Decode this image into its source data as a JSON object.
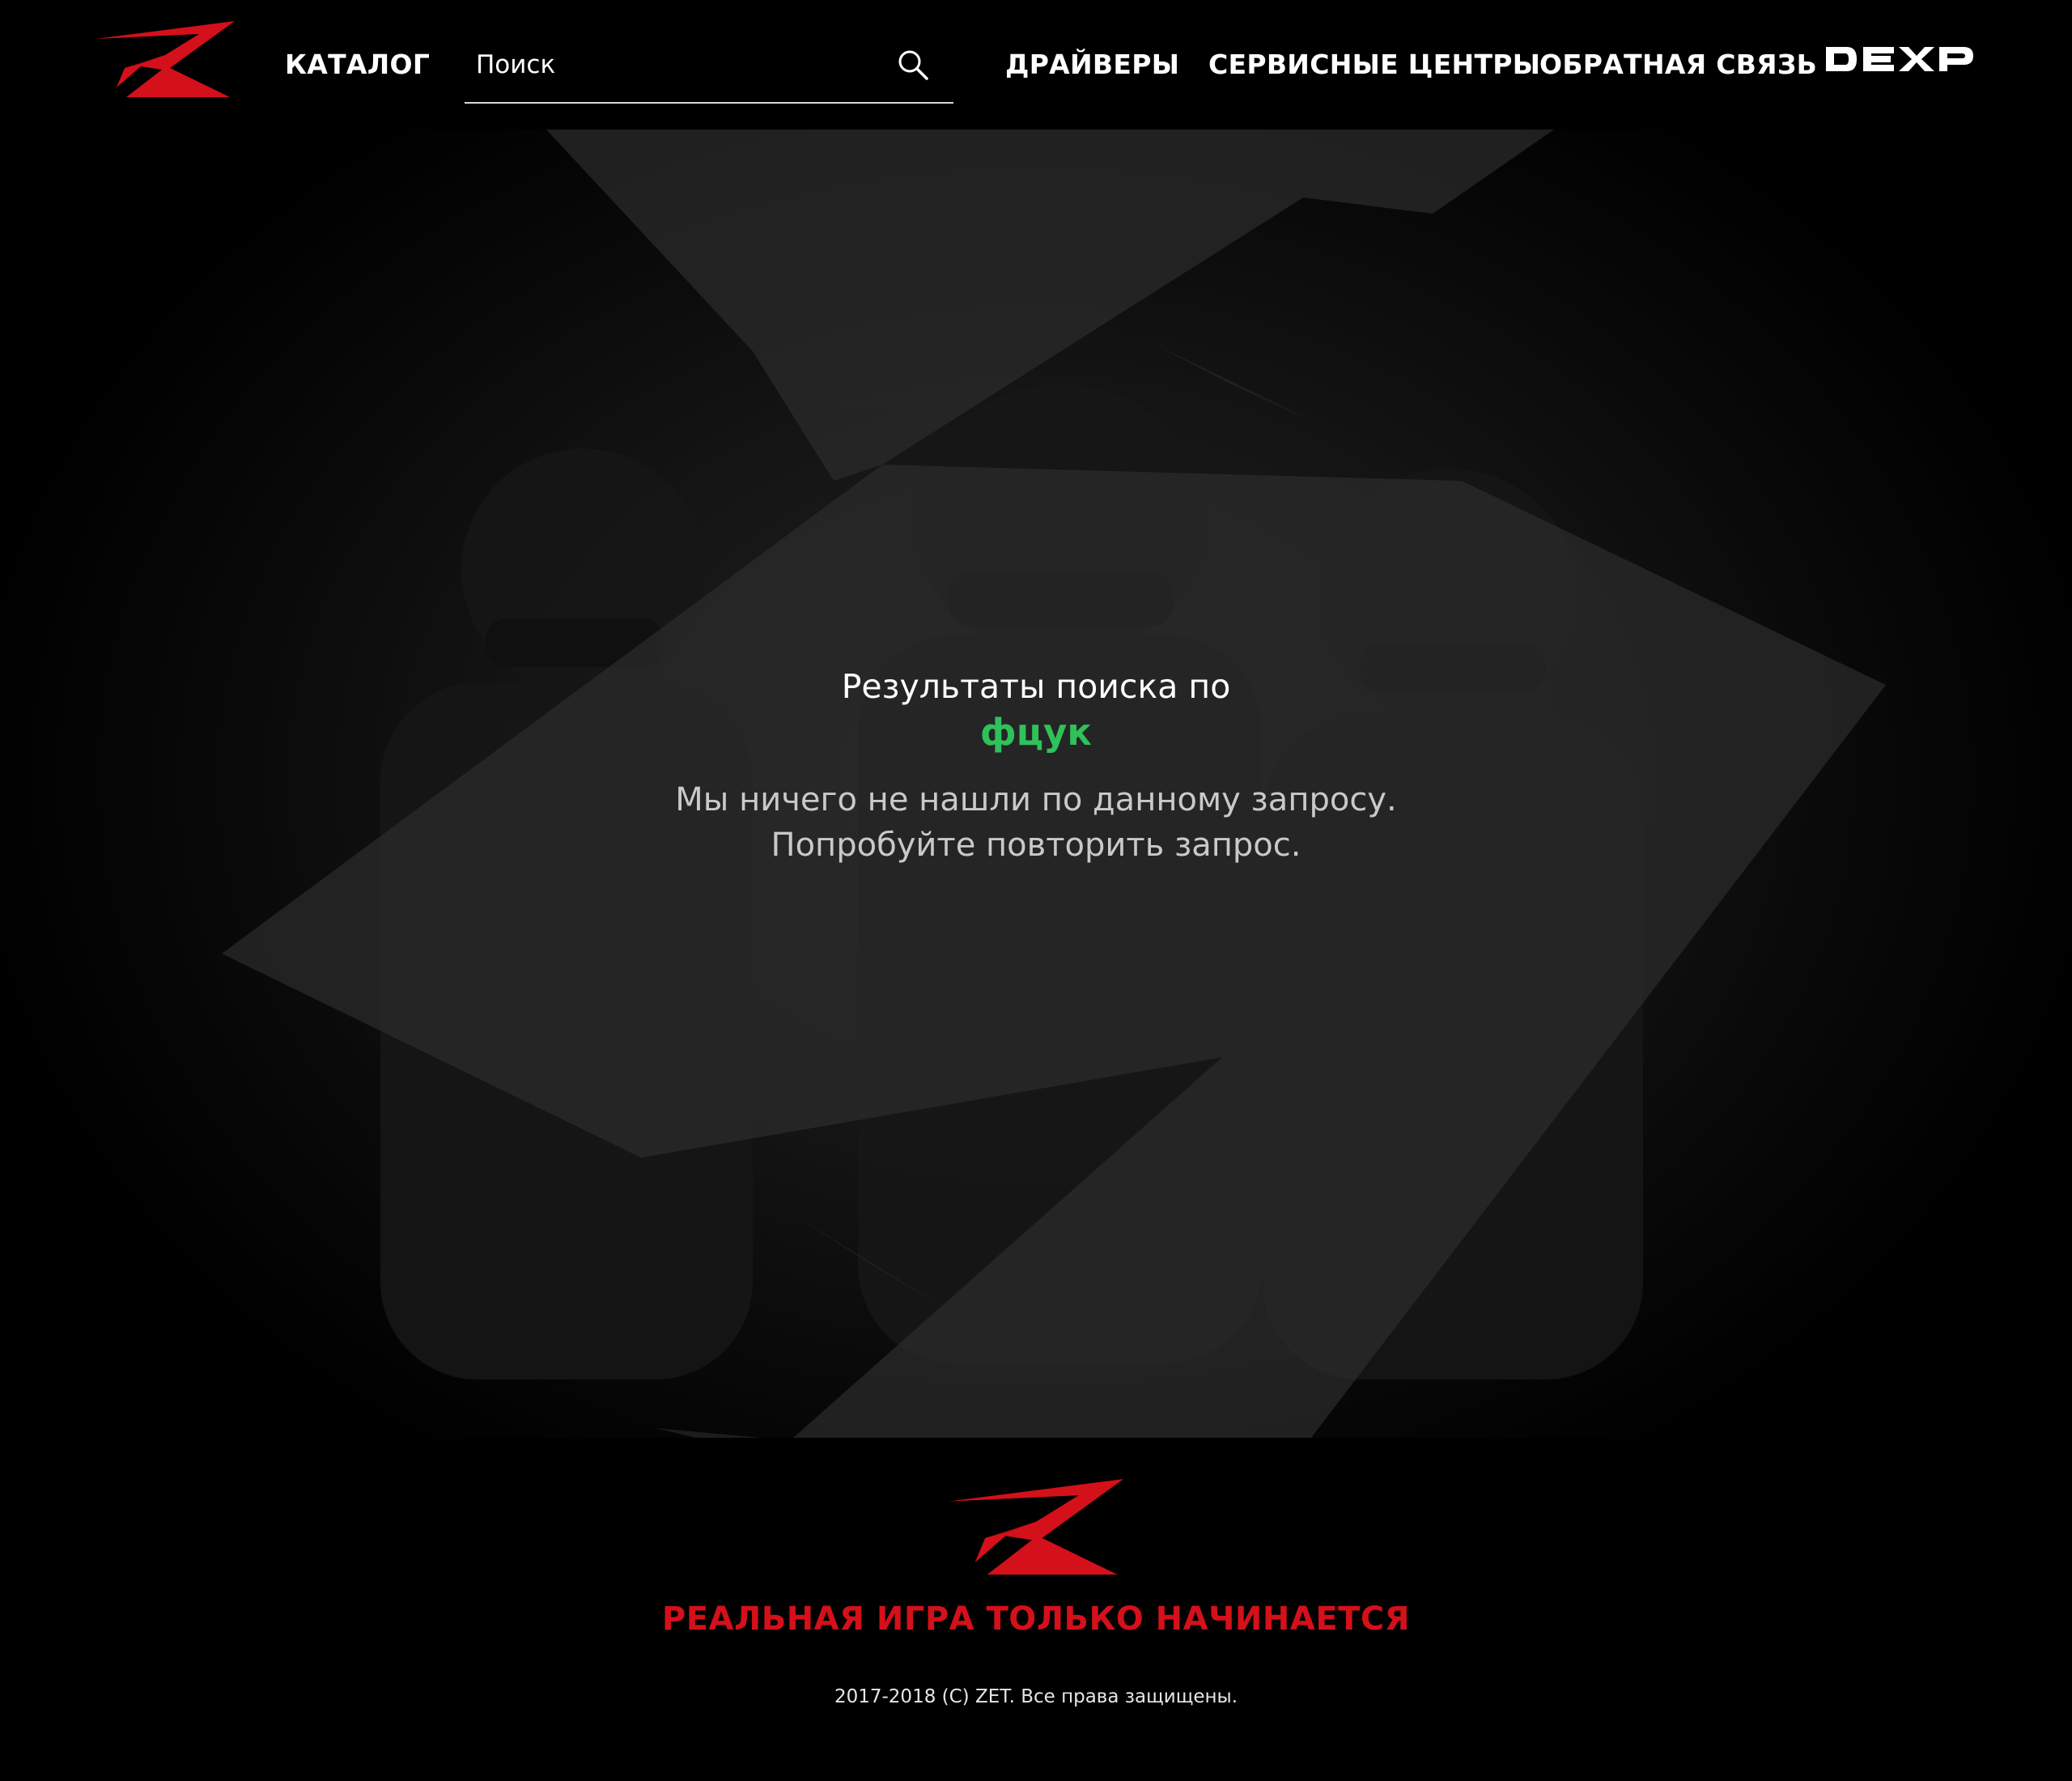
{
  "header": {
    "nav_catalog": "КАТАЛОГ",
    "search_placeholder": "Поиск",
    "nav_drivers": "ДРАЙВЕРЫ",
    "nav_service_centers": "СЕРВИСНЫЕ ЦЕНТРЫ",
    "nav_feedback": "ОБРАТНАЯ СВЯЗЬ",
    "brand_logo_text": "DEXP",
    "logo_icon": "zet-logo-icon"
  },
  "results": {
    "title": "Результаты поиска по",
    "query": "фцук",
    "message_line1": "Мы ничего не нашли по данному запросу.",
    "message_line2": "Попробуйте повторить запрос."
  },
  "footer": {
    "slogan": "РЕАЛЬНАЯ ИГРА ТОЛЬКО НАЧИНАЕТСЯ",
    "copyright": "2017-2018 (C) ZET. Все права защищены."
  },
  "colors": {
    "background": "#000000",
    "accent_red": "#d4101a",
    "query_green": "#2fc15a",
    "text_white": "#ffffff",
    "text_muted": "#c9c9c9"
  }
}
